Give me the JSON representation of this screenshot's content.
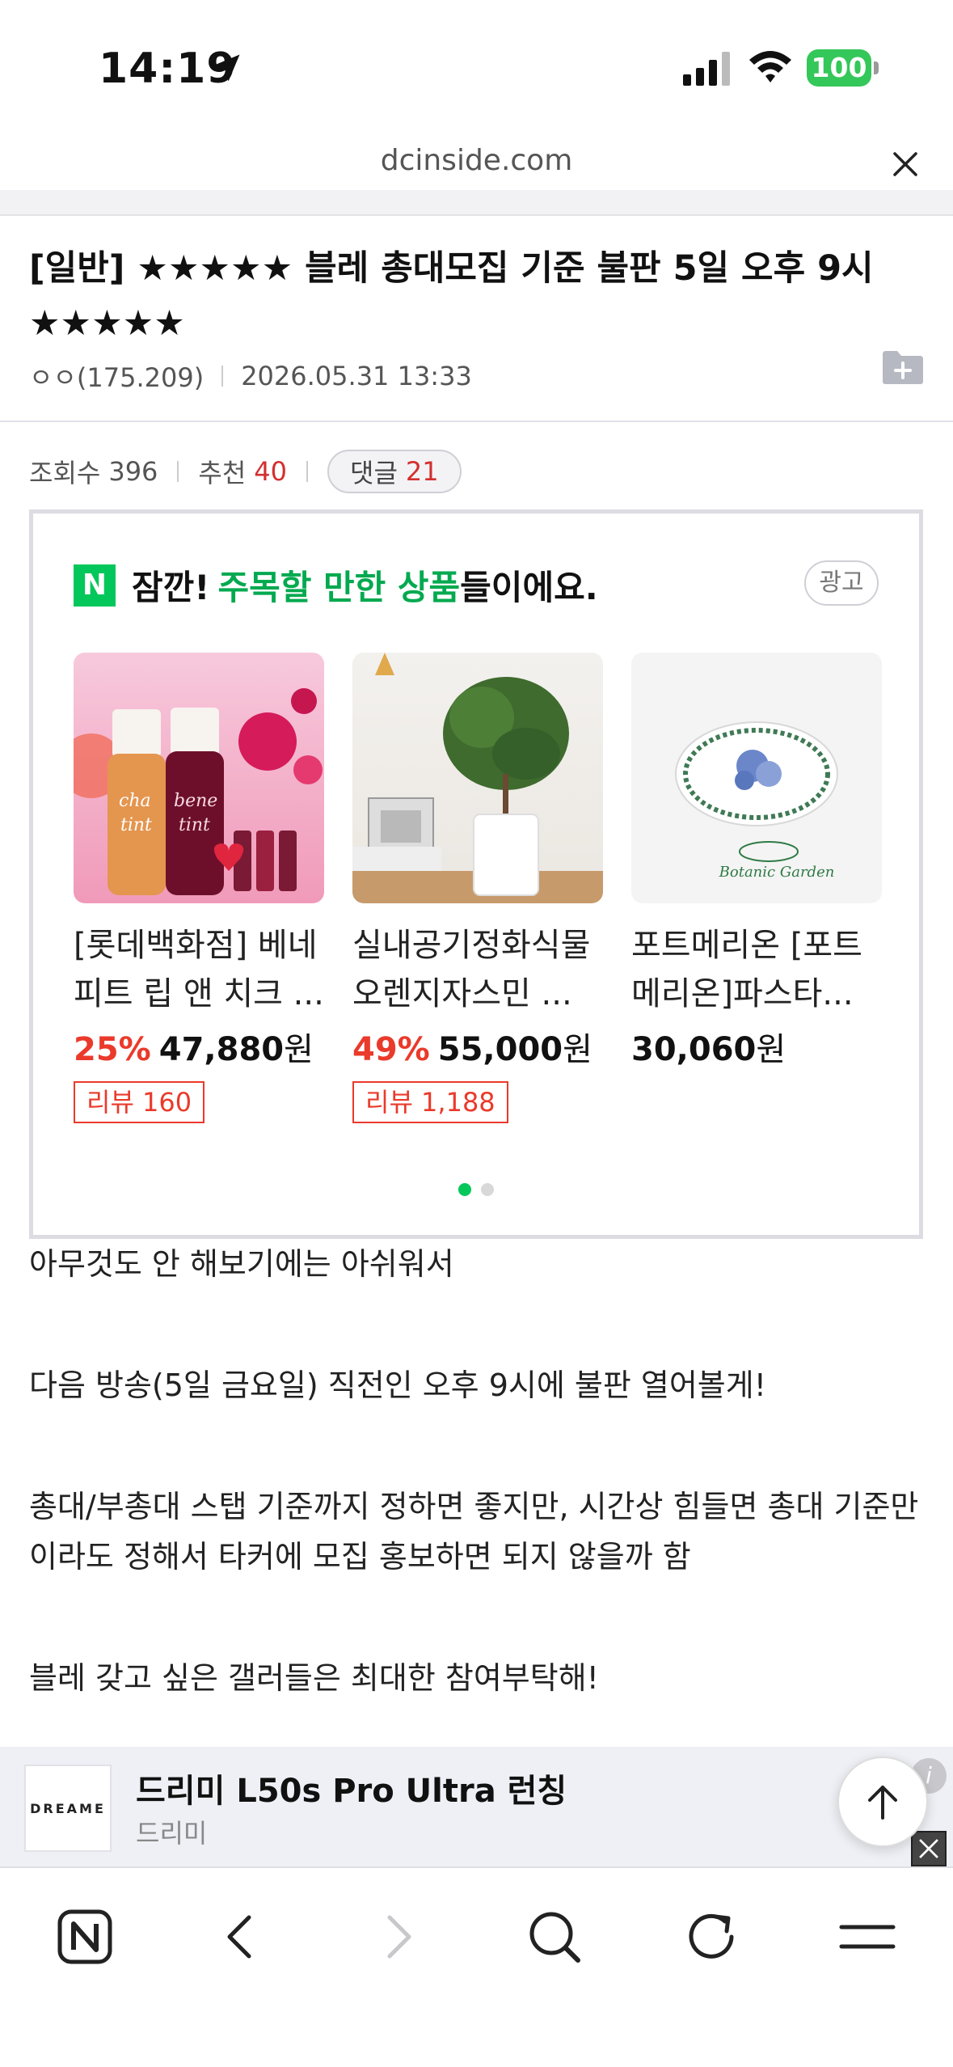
{
  "status_bar": {
    "time": "14:19",
    "battery": "100",
    "icons": [
      "location-arrow-icon",
      "cellular-signal-icon",
      "wifi-icon",
      "battery-icon"
    ]
  },
  "browser": {
    "url": "dcinside.com",
    "close_icon": "close-icon"
  },
  "post": {
    "title": "[일반] ★★★★★ 블레 총대모집 기준 불판 5일 오후 9시 ★★★★★",
    "author": "ㅇㅇ(175.209)",
    "datetime": "2026.05.31 13:33",
    "views_label": "조회수",
    "views": "396",
    "recommend_label": "추천",
    "recommend": "40",
    "comments_label": "댓글",
    "comments": "21"
  },
  "ad_box": {
    "heading_prefix": "잠깐! ",
    "heading_highlight": "주목할 만한 상품",
    "heading_suffix": "들이에요.",
    "badge": "광고",
    "products": [
      {
        "name": "[롯데백화점] 베네피트 립 앤 치크 ...",
        "discount": "25%",
        "price": "47,880",
        "currency": "원",
        "review": "리뷰 160"
      },
      {
        "name": "실내공기정화식물 오렌지자스민 ...",
        "discount": "49%",
        "price": "55,000",
        "currency": "원",
        "review": "리뷰 1,188"
      },
      {
        "name": "포트메리온 [포트메리온]파스타...",
        "discount": "",
        "price": "30,060",
        "currency": "원",
        "review": ""
      }
    ],
    "page_count": 2,
    "active_page": 1
  },
  "body": {
    "paragraphs": [
      "아무것도 안 해보기에는 아쉬워서",
      "다음 방송(5일 금요일) 직전인 오후 9시에 불판 열어볼게!",
      "총대/부총대 스탭 기준까지 정하면 좋지만, 시간상 힘들면 총대 기준만이라도 정해서 타커에 모집 홍보하면 되지 않을까 함",
      "블레 갖고 싶은 갤러들은 최대한 참여부탁해!"
    ]
  },
  "bottom_ad": {
    "logo_text": "DREAME",
    "title": "드리미 L50s Pro Ultra 런칭",
    "subtitle": "드리미",
    "info": "i"
  },
  "toolbar": {
    "icons": [
      "naver-n-icon",
      "back-icon",
      "forward-icon",
      "search-icon",
      "reload-icon",
      "menu-icon"
    ]
  },
  "colors": {
    "accent_green": "#03c75a",
    "discount_red": "#ea3a2b",
    "battery_green": "#34c759"
  }
}
